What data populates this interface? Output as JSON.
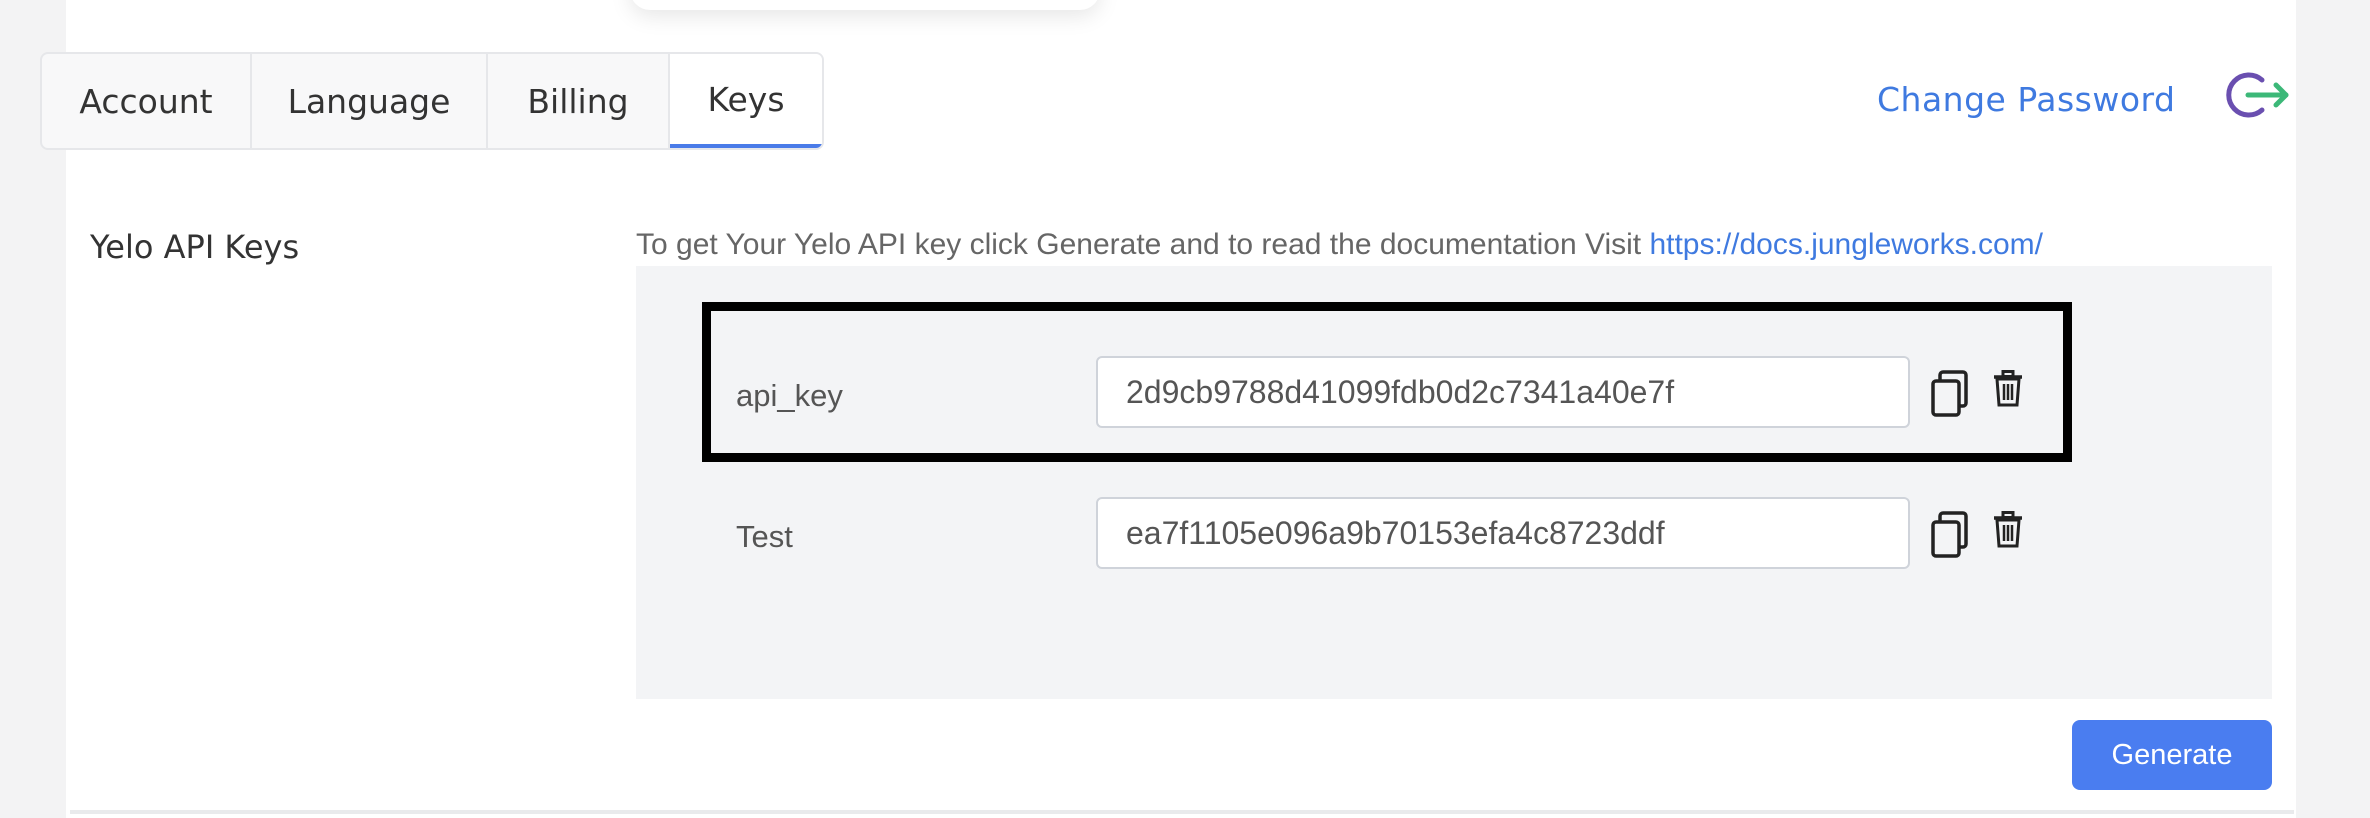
{
  "tabs": [
    {
      "label": "Account"
    },
    {
      "label": "Language"
    },
    {
      "label": "Billing"
    },
    {
      "label": "Keys",
      "active": true
    }
  ],
  "header": {
    "change_password": "Change Password",
    "logout_icon": "logout-icon"
  },
  "section": {
    "title": "Yelo API Keys",
    "instructions": "To get Your Yelo API key click Generate and to read the documentation Visit ",
    "docs_link": "https://docs.jungleworks.com/"
  },
  "keys": [
    {
      "name": "api_key",
      "value": "2d9cb9788d41099fdb0d2c7341a40e7f",
      "copy_icon": "copy-icon",
      "delete_icon": "trash-icon"
    },
    {
      "name": "Test",
      "value": "ea7f1105e096a9b70153efa4c8723ddf",
      "copy_icon": "copy-icon",
      "delete_icon": "trash-icon"
    }
  ],
  "actions": {
    "generate_label": "Generate"
  },
  "colors": {
    "accent": "#4a7df0",
    "link": "#3f7ae0",
    "logout_purple": "#6a4fb0",
    "logout_green": "#3cb878"
  }
}
